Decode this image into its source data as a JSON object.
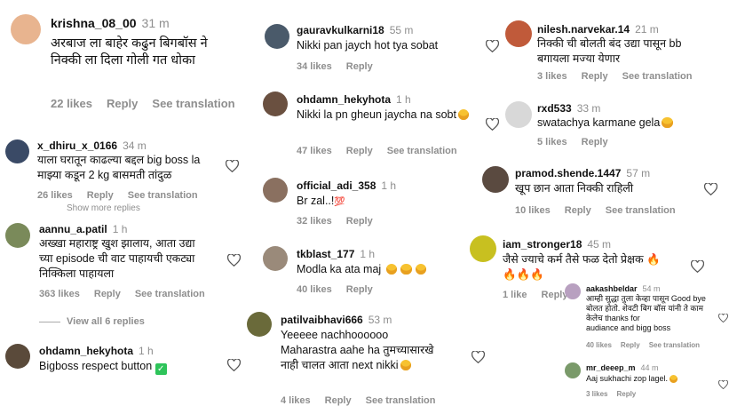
{
  "col1": [
    {
      "user": "krishna_08_00",
      "time": "31 m",
      "text": "अरबाज ला बाहेर कढुन बिगबॉस ने\nनिक्की ला दिला गोली गत धोका",
      "likes": "22 likes",
      "reply": "Reply",
      "translate": "See translation"
    },
    {
      "user": "x_dhiru_x_0166",
      "time": "34 m",
      "text": "याला घरातून काढल्या बद्दल big boss la\nमाझ्या कडून 2 kg बासमती तांदुळ",
      "likes": "26 likes",
      "reply": "Reply",
      "translate": "See translation",
      "more": "Show more replies"
    },
    {
      "user": "aannu_a.patil",
      "time": "1 h",
      "text": "अख्खा महाराष्ट्र खुश झालाय, आता उद्या\nच्या episode ची वाट पाहायची एकट्या\nनिक्किला पाहायला",
      "likes": "363 likes",
      "reply": "Reply",
      "translate": "See translation",
      "viewall": "View all 6 replies"
    },
    {
      "user": "ohdamn_hekyhota",
      "time": "1 h",
      "text": "Bigboss respect button"
    }
  ],
  "col2": [
    {
      "user": "gauravkulkarni18",
      "time": "55 m",
      "text": "Nikki pan jaych hot tya sobat",
      "likes": "34 likes",
      "reply": "Reply"
    },
    {
      "user": "ohdamn_hekyhota",
      "time": "1 h",
      "text": "Nikki la pn gheun jaycha na sobt",
      "likes": "47 likes",
      "reply": "Reply",
      "translate": "See translation"
    },
    {
      "user": "official_adi_358",
      "time": "1 h",
      "text": "Br zal..!",
      "likes": "32 likes",
      "reply": "Reply"
    },
    {
      "user": "tkblast_177",
      "time": "1 h",
      "text": "Modla ka ata maj",
      "likes": "40 likes",
      "reply": "Reply"
    },
    {
      "user": "patilvaibhavi666",
      "time": "53 m",
      "text": "Yeeeee nachhoooooo\nMaharastra aahe ha तुमच्यासारखे\nनाही चालत आता next nikki",
      "likes": "4 likes",
      "reply": "Reply",
      "translate": "See translation"
    }
  ],
  "col3": [
    {
      "user": "nilesh.narvekar.14",
      "time": "21 m",
      "text": "निक्की ची बोलती बंद उद्या पासून bb\nबगायला मज्या येणार",
      "likes": "3 likes",
      "reply": "Reply",
      "translate": "See translation"
    },
    {
      "user": "rxd533",
      "time": "33 m",
      "text": "swatachya karmane gela",
      "likes": "5 likes",
      "reply": "Reply"
    },
    {
      "user": "pramod.shende.1447",
      "time": "57 m",
      "text": "खूप छान आता निक्की राहिली",
      "likes": "10 likes",
      "reply": "Reply",
      "translate": "See translation"
    },
    {
      "user": "iam_stronger18",
      "time": "45 m",
      "text": "जैसे ज्याचे कर्म तैसे फळ देतो प्रेक्षक",
      "likes": "1 like",
      "reply": "Reply"
    },
    {
      "user": "aakashbeldar",
      "time": "54 m",
      "text": "आम्ही सुद्धा तुला केव्हा पासून Good bye\nबोलत होतो. शेवटी बिग बॉस यांनी ते काम\nकेलेच thanks for\naudiance and bigg boss",
      "likes": "40 likes",
      "reply": "Reply",
      "translate": "See translation"
    },
    {
      "user": "mr_deeep_m",
      "time": "44 m",
      "text": "Aaj sukhachi zop lagel.",
      "likes": "3 likes",
      "reply": "Reply"
    }
  ],
  "colors": {
    "muted": "#8e8e8e",
    "text": "#111111",
    "emoji": "#f7c230",
    "check": "#2ec45a"
  }
}
